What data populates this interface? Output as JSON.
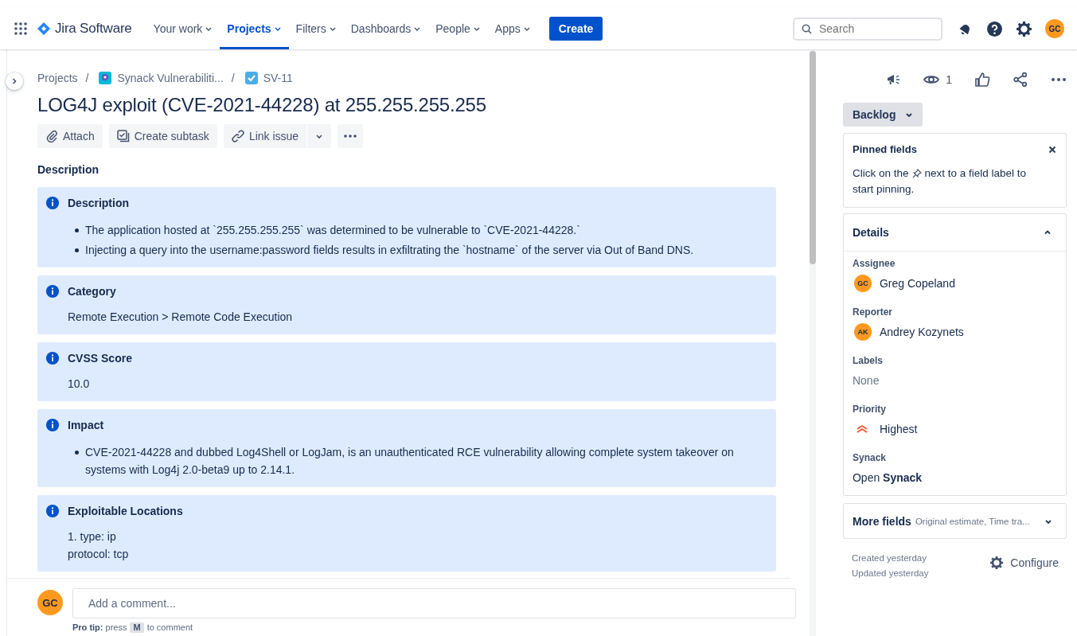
{
  "nav": {
    "product": "Jira Software",
    "items": [
      {
        "label": "Your work",
        "selected": false
      },
      {
        "label": "Projects",
        "selected": true
      },
      {
        "label": "Filters",
        "selected": false
      },
      {
        "label": "Dashboards",
        "selected": false
      },
      {
        "label": "People",
        "selected": false
      },
      {
        "label": "Apps",
        "selected": false
      }
    ],
    "create": "Create",
    "search": {
      "placeholder": "Search"
    },
    "avatar": "GC"
  },
  "breadcrumbs": [
    "Projects",
    "Synack Vulnerabiliti...",
    "SV-11"
  ],
  "breadcrumb_separators": [
    "/",
    "/"
  ],
  "title": "LOG4J exploit (CVE-2021-44228) at 255.255.255.255",
  "actions": [
    "Attach",
    "Create subtask",
    "Link issue"
  ],
  "description_heading": "Description",
  "panels": [
    {
      "title": "Description",
      "kind": "bullets",
      "lines": [
        "The application hosted at `255.255.255.255` was determined to be vulnerable to `CVE-2021-44228.`",
        "Injecting a query into the username:password fields results in exfiltrating the `hostname` of the server via Out of Band DNS."
      ]
    },
    {
      "title": "Category",
      "kind": "text",
      "lines": [
        "Remote Execution > Remote Code Execution"
      ]
    },
    {
      "title": "CVSS Score",
      "kind": "text",
      "lines": [
        "10.0"
      ]
    },
    {
      "title": "Impact",
      "kind": "bullets",
      "lines": [
        "CVE-2021-44228 and dubbed Log4Shell or LogJam, is an unauthenticated RCE vulnerability allowing complete system takeover on systems with Log4j 2.0-beta9 up to 2.14.1."
      ]
    },
    {
      "title": "Exploitable Locations",
      "kind": "text",
      "lines": [
        "1. type: ip",
        "protocol: tcp"
      ]
    }
  ],
  "comment": {
    "avatar": "GC",
    "placeholder": "Add a comment...",
    "tip": "**Pro tip:** press",
    "key": "M",
    "tip_end": "to comment"
  },
  "side": {
    "watchers": "1",
    "status": "Backlog",
    "pinned": {
      "title": "Pinned fields",
      "text_before": "Click on the",
      "text_after": "next to a field label to",
      "text_end": "start pinning."
    },
    "details_title": "Details",
    "fields": [
      {
        "label": "Assignee",
        "kind": "user",
        "value": "Greg Copeland",
        "initials": "GC"
      },
      {
        "label": "Reporter",
        "kind": "user",
        "value": "Andrey Kozynets",
        "initials": "AK"
      },
      {
        "label": "Labels",
        "kind": "empty",
        "value": "None"
      },
      {
        "label": "Priority",
        "kind": "priority",
        "value": "Highest"
      },
      {
        "label": "Synack",
        "kind": "link",
        "value": "Open **Synack**"
      }
    ],
    "more_fields": "More fields",
    "more_hint": "Original estimate, Time tra...",
    "created": "Created yesterday",
    "updated": "Updated yesterday",
    "configure": "Configure"
  }
}
